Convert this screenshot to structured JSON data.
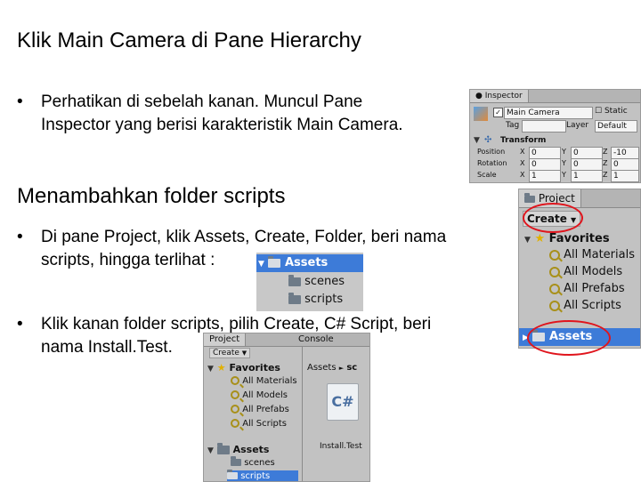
{
  "slide": {
    "title": "Klik Main Camera di Pane Hierarchy",
    "bullet1": "Perhatikan di sebelah kanan. Muncul Pane\nInspector yang berisi karakteristik Main Camera.",
    "heading2": "Menambahkan folder scripts",
    "bullet2_line1": "Di pane Project, klik Assets, Create, Folder, beri nama",
    "bullet2_line2": "scripts, hingga terlihat :",
    "bullet3": "Klik kanan folder scripts, pilih Create, C# Script, beri\nnama Install.Test.",
    "bullet_glyph": "•"
  },
  "inspector": {
    "tab": "Inspector",
    "object_name": "Main Camera",
    "static_label": "Static",
    "tag_label": "Tag",
    "layer_label": "Layer",
    "layer_value": "Default",
    "transform_label": "Transform",
    "rows": [
      {
        "label": "Position",
        "x": "0",
        "y": "0",
        "z": "-10"
      },
      {
        "label": "Rotation",
        "x": "0",
        "y": "0",
        "z": "0"
      },
      {
        "label": "Scale",
        "x": "1",
        "y": "1",
        "z": "1"
      }
    ],
    "axis_x": "X",
    "axis_y": "Y",
    "axis_z": "Z"
  },
  "folder_list": {
    "assets": "Assets",
    "scenes": "scenes",
    "scripts": "scripts"
  },
  "project_right": {
    "tab": "Project",
    "create": "Create",
    "favorites": "Favorites",
    "items": [
      "All Materials",
      "All Models",
      "All Prefabs",
      "All Scripts"
    ],
    "assets": "Assets"
  },
  "project_bottom": {
    "tab_project": "Project",
    "tab_console": "Console",
    "create": "Create",
    "favorites": "Favorites",
    "items": [
      "All Materials",
      "All Models",
      "All Prefabs",
      "All Scripts"
    ],
    "breadcrumb": "Assets",
    "breadcrumb_sep": "►",
    "breadcrumb_next": "sc",
    "assets": "Assets",
    "scenes": "scenes",
    "scripts": "scripts",
    "file_name": "Install.Test",
    "file_icon_text": "C#"
  }
}
